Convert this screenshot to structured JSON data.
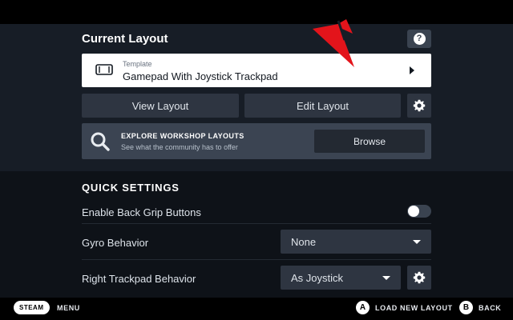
{
  "header": {
    "section_title": "Current Layout",
    "help_glyph": "?"
  },
  "template": {
    "label": "Template",
    "value": "Gamepad With Joystick Trackpad",
    "icon": "controller-icon"
  },
  "actions": {
    "view_label": "View Layout",
    "edit_label": "Edit Layout"
  },
  "workshop": {
    "title": "EXPLORE WORKSHOP LAYOUTS",
    "subtitle": "See what the community has to offer",
    "browse_label": "Browse"
  },
  "quick_settings": {
    "title": "QUICK SETTINGS",
    "rows": [
      {
        "label": "Enable Back Grip Buttons",
        "control": "toggle",
        "enabled": false
      },
      {
        "label": "Gyro Behavior",
        "control": "dropdown",
        "value": "None"
      },
      {
        "label": "Right Trackpad Behavior",
        "control": "dropdown",
        "value": "As Joystick"
      }
    ]
  },
  "footer": {
    "steam_label": "STEAM",
    "menu_label": "MENU",
    "a_glyph": "A",
    "load_label": "LOAD NEW LAYOUT",
    "b_glyph": "B",
    "back_label": "BACK"
  },
  "colors": {
    "accent_red": "#e3141b",
    "panel": "#171d26",
    "button": "#2e3541"
  }
}
